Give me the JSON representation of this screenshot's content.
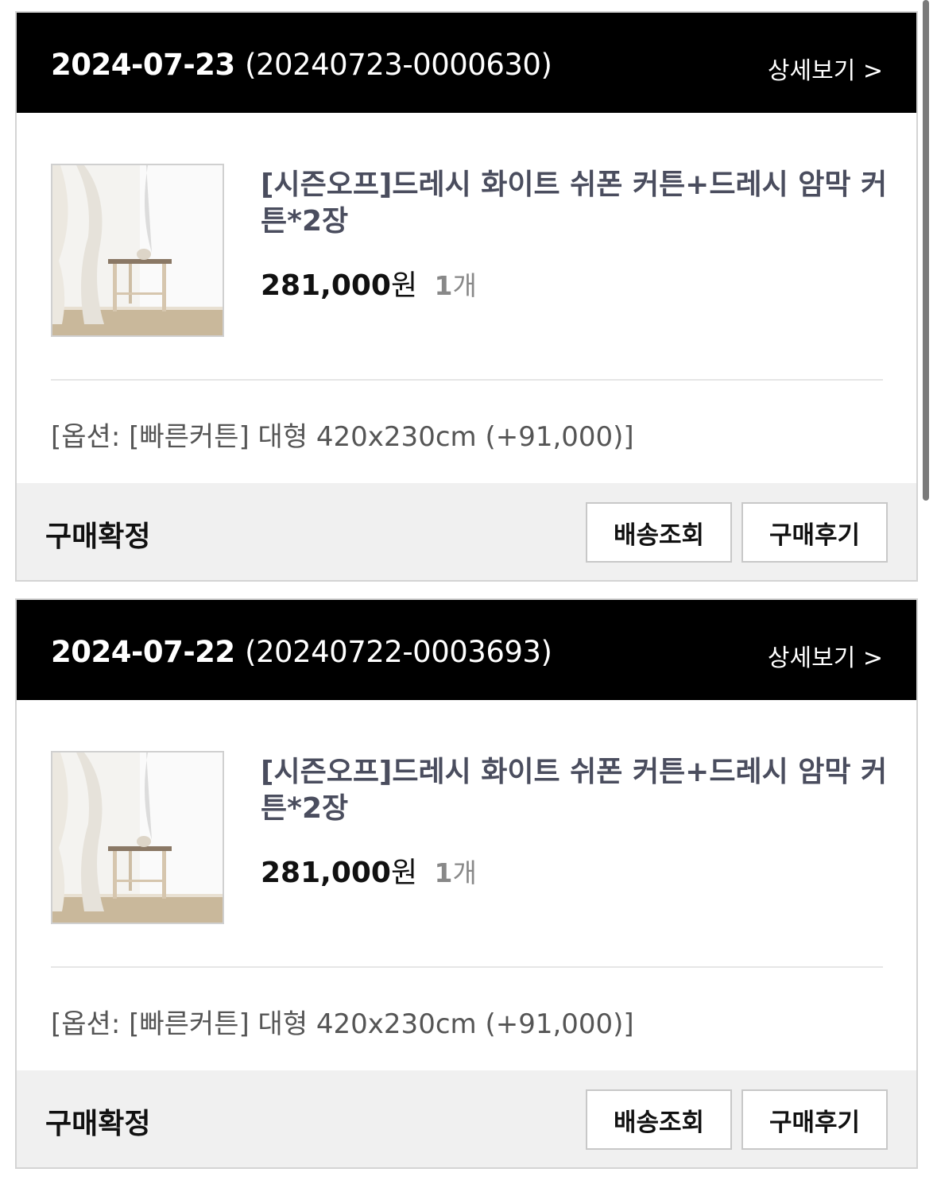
{
  "orders": [
    {
      "date": "2024-07-23",
      "order_number": "(20240723-0000630)",
      "detail_link": "상세보기 >",
      "product_name": "[시즌오프]드레시 화이트 쉬폰 커튼+드레시 암막 커튼*2장",
      "price": "281,000",
      "currency": "원",
      "qty_number": "1",
      "qty_unit": "개",
      "option": "[옵션: [빠른커튼] 대형 420x230cm (+91,000)]",
      "status": "구매확정",
      "track_button": "배송조회",
      "review_button": "구매후기"
    },
    {
      "date": "2024-07-22",
      "order_number": "(20240722-0003693)",
      "detail_link": "상세보기 >",
      "product_name": "[시즌오프]드레시 화이트 쉬폰 커튼+드레시 암막 커튼*2장",
      "price": "281,000",
      "currency": "원",
      "qty_number": "1",
      "qty_unit": "개",
      "option": "[옵션: [빠른커튼] 대형 420x230cm (+91,000)]",
      "status": "구매확정",
      "track_button": "배송조회",
      "review_button": "구매후기"
    }
  ]
}
